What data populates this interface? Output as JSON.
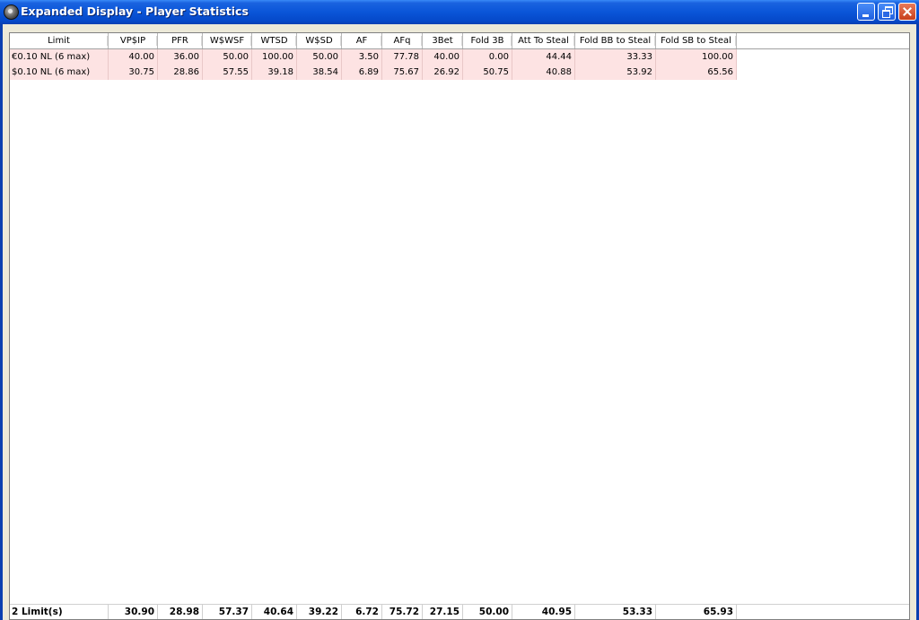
{
  "window": {
    "title": "Expanded Display - Player Statistics"
  },
  "columns": [
    "Limit",
    "VP$IP",
    "PFR",
    "W$WSF",
    "WTSD",
    "W$SD",
    "AF",
    "AFq",
    "3Bet",
    "Fold 3B",
    "Att To Steal",
    "Fold BB to Steal",
    "Fold SB to Steal"
  ],
  "rows": [
    [
      "€0.10 NL (6 max)",
      "40.00",
      "36.00",
      "50.00",
      "100.00",
      "50.00",
      "3.50",
      "77.78",
      "40.00",
      "0.00",
      "44.44",
      "33.33",
      "100.00"
    ],
    [
      "$0.10 NL (6 max)",
      "30.75",
      "28.86",
      "57.55",
      "39.18",
      "38.54",
      "6.89",
      "75.67",
      "26.92",
      "50.75",
      "40.88",
      "53.92",
      "65.56"
    ]
  ],
  "footer": [
    "2 Limit(s)",
    "30.90",
    "28.98",
    "57.37",
    "40.64",
    "39.22",
    "6.72",
    "75.72",
    "27.15",
    "50.00",
    "40.95",
    "53.33",
    "65.93"
  ],
  "colors": {
    "row_highlight": "#fde3e3",
    "titlebar": "#0a55d8"
  }
}
